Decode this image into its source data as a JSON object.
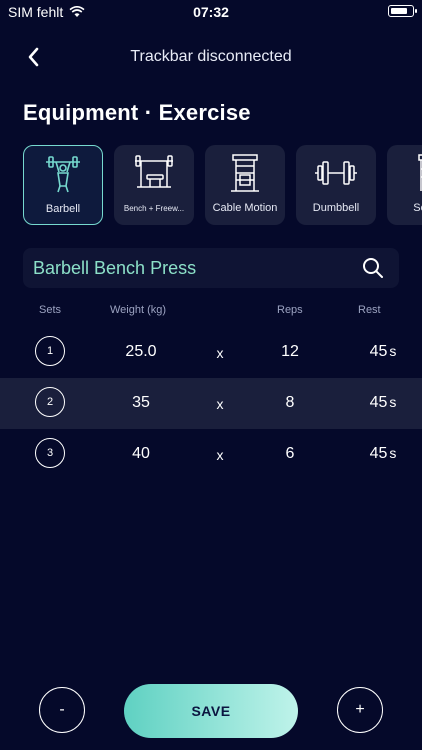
{
  "status_bar": {
    "carrier": "SIM fehlt",
    "time": "07:32",
    "battery_level": 0.85
  },
  "nav": {
    "title": "Trackbar disconnected"
  },
  "section_title": "Equipment · Exercise",
  "equipment": [
    {
      "label": "Barbell",
      "icon": "barbell-rack-icon",
      "selected": true
    },
    {
      "label": "Bench + Freew...",
      "icon": "bench-icon",
      "selected": false
    },
    {
      "label": "Cable Motion",
      "icon": "cable-machine-icon",
      "selected": false
    },
    {
      "label": "Dumbbell",
      "icon": "dumbbell-icon",
      "selected": false
    },
    {
      "label": "Selec",
      "icon": "selectorized-machine-icon",
      "selected": false
    }
  ],
  "search": {
    "value": "Barbell Bench Press",
    "icon": "search-icon"
  },
  "table": {
    "headers": {
      "sets": "Sets",
      "weight": "Weight (kg)",
      "reps": "Reps",
      "rest": "Rest"
    },
    "multiply": "x",
    "rows": [
      {
        "set": "1",
        "weight": "25.0",
        "reps": "12",
        "rest": "45",
        "rest_unit": "s"
      },
      {
        "set": "2",
        "weight": "35",
        "reps": "8",
        "rest": "45",
        "rest_unit": "s"
      },
      {
        "set": "3",
        "weight": "40",
        "reps": "6",
        "rest": "45",
        "rest_unit": "s"
      }
    ]
  },
  "actions": {
    "minus": "-",
    "save": "SAVE",
    "plus": "+"
  },
  "colors": {
    "background": "#05092a",
    "card": "#1a1f3c",
    "accent": "#76d9cf",
    "search_text": "#8ce0c8"
  }
}
